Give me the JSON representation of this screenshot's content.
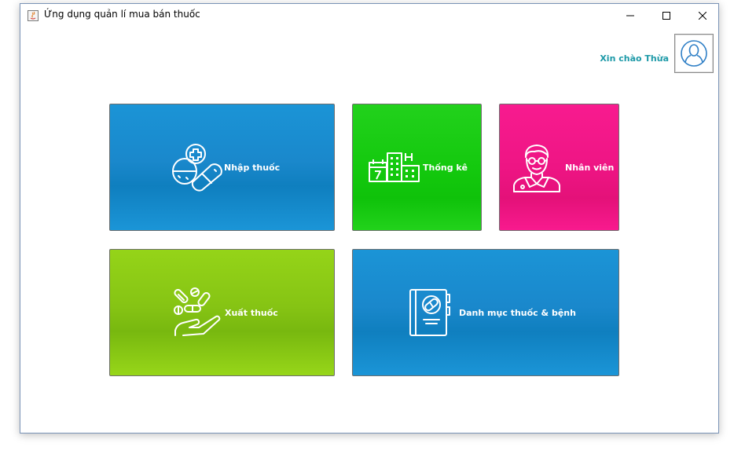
{
  "window": {
    "title": "Ứng dụng quản lí mua bán thuốc"
  },
  "header": {
    "greeting": "Xin chào Thừa",
    "avatar_icon": "user-icon"
  },
  "tiles": {
    "import": {
      "label": "Nhập thuốc",
      "icon": "pills-icon",
      "color": "#1a88cc"
    },
    "stats": {
      "label": "Thống kê",
      "icon": "hospital-calendar-icon",
      "color": "#14c90e"
    },
    "staff": {
      "label": "Nhân viên",
      "icon": "doctor-icon",
      "color": "#ee1584"
    },
    "export": {
      "label": "Xuất thuốc",
      "icon": "hand-pills-icon",
      "color": "#86c414"
    },
    "catalog": {
      "label": "Danh mục thuốc & bệnh",
      "icon": "medicine-book-icon",
      "color": "#1a88cc"
    }
  },
  "colors": {
    "greeting_text": "#1e9aa8"
  }
}
